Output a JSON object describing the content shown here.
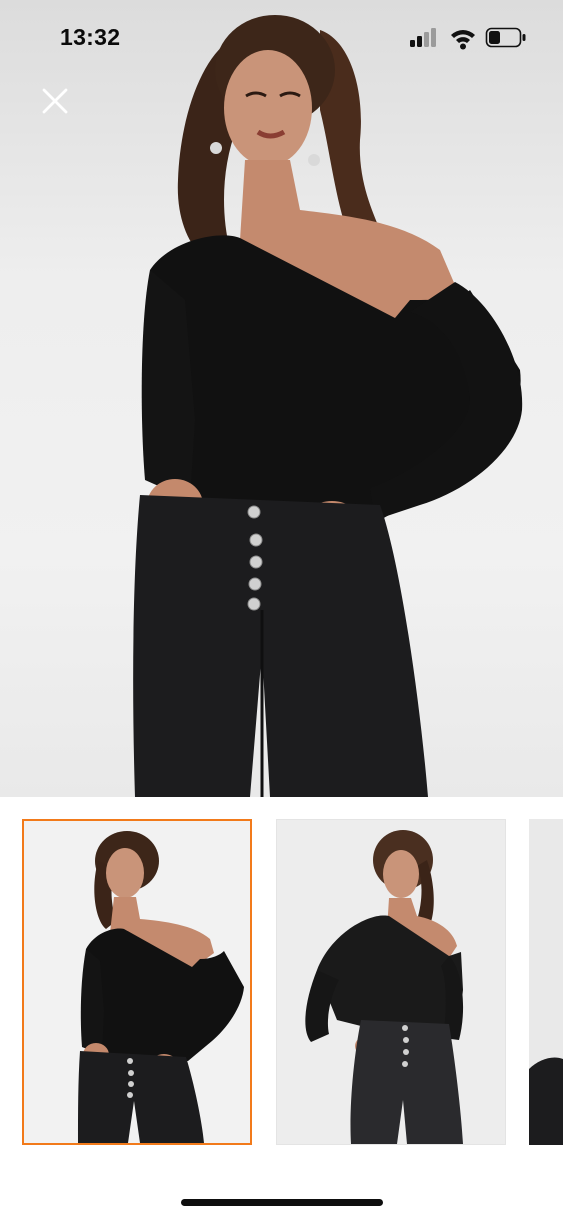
{
  "status_bar": {
    "time": "13:32",
    "icons": [
      "cellular-signal-icon",
      "wifi-icon",
      "battery-icon"
    ]
  },
  "hero": {
    "close_icon": "close-icon",
    "image_subject": "model-one-shoulder-bodysuit-front"
  },
  "gallery": {
    "thumbnails": [
      {
        "name": "thumbnail-1",
        "selected": true
      },
      {
        "name": "thumbnail-2",
        "selected": false
      },
      {
        "name": "thumbnail-3",
        "selected": false
      }
    ]
  },
  "colors": {
    "accent": "#f27a1a",
    "garment": "#111111",
    "denim": "#1c1c1e"
  }
}
